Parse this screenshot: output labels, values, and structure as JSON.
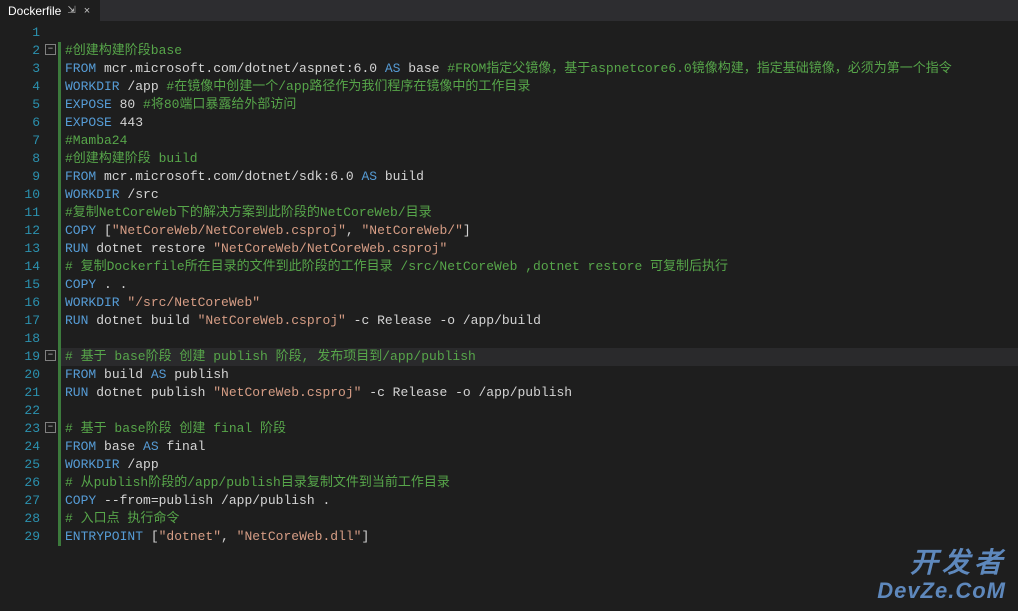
{
  "tab": {
    "title": "Dockerfile",
    "pin_glyph": "⇲",
    "close_glyph": "×"
  },
  "fold": {
    "glyph": "−"
  },
  "highlighted_line": 19,
  "watermark": {
    "line1": "开发者",
    "line2": "DevZe.CoM"
  },
  "lines": [
    {
      "n": 1,
      "fold": false,
      "indent": false,
      "tokens": []
    },
    {
      "n": 2,
      "fold": true,
      "indent": true,
      "tokens": [
        {
          "cls": "c-comment",
          "t": "#创建构建阶段base"
        }
      ]
    },
    {
      "n": 3,
      "fold": false,
      "indent": true,
      "tokens": [
        {
          "cls": "c-keyword",
          "t": "FROM"
        },
        {
          "cls": "c-text",
          "t": " mcr.microsoft.com/dotnet/aspnet:6.0 "
        },
        {
          "cls": "c-keyword",
          "t": "AS"
        },
        {
          "cls": "c-text",
          "t": " base "
        },
        {
          "cls": "c-comment",
          "t": "#FROM指定父镜像，基于aspnetcore6.0镜像构建，指定基础镜像，必须为第一个指令"
        }
      ]
    },
    {
      "n": 4,
      "fold": false,
      "indent": true,
      "tokens": [
        {
          "cls": "c-keyword",
          "t": "WORKDIR"
        },
        {
          "cls": "c-text",
          "t": " /app "
        },
        {
          "cls": "c-comment",
          "t": "#在镜像中创建一个/app路径作为我们程序在镜像中的工作目录"
        }
      ]
    },
    {
      "n": 5,
      "fold": false,
      "indent": true,
      "tokens": [
        {
          "cls": "c-keyword",
          "t": "EXPOSE"
        },
        {
          "cls": "c-text",
          "t": " 80 "
        },
        {
          "cls": "c-comment",
          "t": "#将80端口暴露给外部访问"
        }
      ]
    },
    {
      "n": 6,
      "fold": false,
      "indent": true,
      "tokens": [
        {
          "cls": "c-keyword",
          "t": "EXPOSE"
        },
        {
          "cls": "c-text",
          "t": " 443"
        }
      ]
    },
    {
      "n": 7,
      "fold": false,
      "indent": true,
      "tokens": [
        {
          "cls": "c-comment",
          "t": "#Mamba24"
        }
      ]
    },
    {
      "n": 8,
      "fold": false,
      "indent": true,
      "tokens": [
        {
          "cls": "c-comment",
          "t": "#创建构建阶段 build"
        }
      ]
    },
    {
      "n": 9,
      "fold": false,
      "indent": true,
      "tokens": [
        {
          "cls": "c-keyword",
          "t": "FROM"
        },
        {
          "cls": "c-text",
          "t": " mcr.microsoft.com/dotnet/sdk:6.0 "
        },
        {
          "cls": "c-keyword",
          "t": "AS"
        },
        {
          "cls": "c-text",
          "t": " build"
        }
      ]
    },
    {
      "n": 10,
      "fold": false,
      "indent": true,
      "tokens": [
        {
          "cls": "c-keyword",
          "t": "WORKDIR"
        },
        {
          "cls": "c-text",
          "t": " /src"
        }
      ]
    },
    {
      "n": 11,
      "fold": false,
      "indent": true,
      "tokens": [
        {
          "cls": "c-comment",
          "t": "#复制NetCoreWeb下的解决方案到此阶段的NetCoreWeb/目录"
        }
      ]
    },
    {
      "n": 12,
      "fold": false,
      "indent": true,
      "tokens": [
        {
          "cls": "c-keyword",
          "t": "COPY"
        },
        {
          "cls": "c-text",
          "t": " ["
        },
        {
          "cls": "c-string",
          "t": "\"NetCoreWeb/NetCoreWeb.csproj\""
        },
        {
          "cls": "c-text",
          "t": ", "
        },
        {
          "cls": "c-string",
          "t": "\"NetCoreWeb/\""
        },
        {
          "cls": "c-text",
          "t": "]"
        }
      ]
    },
    {
      "n": 13,
      "fold": false,
      "indent": true,
      "tokens": [
        {
          "cls": "c-keyword",
          "t": "RUN"
        },
        {
          "cls": "c-text",
          "t": " dotnet restore "
        },
        {
          "cls": "c-string",
          "t": "\"NetCoreWeb/NetCoreWeb.csproj\""
        }
      ]
    },
    {
      "n": 14,
      "fold": false,
      "indent": true,
      "tokens": [
        {
          "cls": "c-comment",
          "t": "# 复制Dockerfile所在目录的文件到此阶段的工作目录 /src/NetCoreWeb ,dotnet restore 可复制后执行"
        }
      ]
    },
    {
      "n": 15,
      "fold": false,
      "indent": true,
      "tokens": [
        {
          "cls": "c-keyword",
          "t": "COPY"
        },
        {
          "cls": "c-text",
          "t": " . ."
        }
      ]
    },
    {
      "n": 16,
      "fold": false,
      "indent": true,
      "tokens": [
        {
          "cls": "c-keyword",
          "t": "WORKDIR"
        },
        {
          "cls": "c-text",
          "t": " "
        },
        {
          "cls": "c-string",
          "t": "\"/src/NetCoreWeb\""
        }
      ]
    },
    {
      "n": 17,
      "fold": false,
      "indent": true,
      "tokens": [
        {
          "cls": "c-keyword",
          "t": "RUN"
        },
        {
          "cls": "c-text",
          "t": " dotnet build "
        },
        {
          "cls": "c-string",
          "t": "\"NetCoreWeb.csproj\""
        },
        {
          "cls": "c-text",
          "t": " -c Release -o /app/build"
        }
      ]
    },
    {
      "n": 18,
      "fold": false,
      "indent": true,
      "tokens": []
    },
    {
      "n": 19,
      "fold": true,
      "indent": true,
      "tokens": [
        {
          "cls": "c-comment",
          "t": "# 基于 base阶段 创建 publish 阶段, 发布项目到/app/publish"
        }
      ]
    },
    {
      "n": 20,
      "fold": false,
      "indent": true,
      "tokens": [
        {
          "cls": "c-keyword",
          "t": "FROM"
        },
        {
          "cls": "c-text",
          "t": " build "
        },
        {
          "cls": "c-keyword",
          "t": "AS"
        },
        {
          "cls": "c-text",
          "t": " publish"
        }
      ]
    },
    {
      "n": 21,
      "fold": false,
      "indent": true,
      "tokens": [
        {
          "cls": "c-keyword",
          "t": "RUN"
        },
        {
          "cls": "c-text",
          "t": " dotnet publish "
        },
        {
          "cls": "c-string",
          "t": "\"NetCoreWeb.csproj\""
        },
        {
          "cls": "c-text",
          "t": " -c Release -o /app/publish"
        }
      ]
    },
    {
      "n": 22,
      "fold": false,
      "indent": true,
      "tokens": []
    },
    {
      "n": 23,
      "fold": true,
      "indent": true,
      "tokens": [
        {
          "cls": "c-comment",
          "t": "# 基于 base阶段 创建 final 阶段"
        }
      ]
    },
    {
      "n": 24,
      "fold": false,
      "indent": true,
      "tokens": [
        {
          "cls": "c-keyword",
          "t": "FROM"
        },
        {
          "cls": "c-text",
          "t": " base "
        },
        {
          "cls": "c-keyword",
          "t": "AS"
        },
        {
          "cls": "c-text",
          "t": " final"
        }
      ]
    },
    {
      "n": 25,
      "fold": false,
      "indent": true,
      "tokens": [
        {
          "cls": "c-keyword",
          "t": "WORKDIR"
        },
        {
          "cls": "c-text",
          "t": " /app"
        }
      ]
    },
    {
      "n": 26,
      "fold": false,
      "indent": true,
      "tokens": [
        {
          "cls": "c-comment",
          "t": "# 从publish阶段的/app/publish目录复制文件到当前工作目录"
        }
      ]
    },
    {
      "n": 27,
      "fold": false,
      "indent": true,
      "tokens": [
        {
          "cls": "c-keyword",
          "t": "COPY"
        },
        {
          "cls": "c-text",
          "t": " --from=publish /app/publish ."
        }
      ]
    },
    {
      "n": 28,
      "fold": false,
      "indent": true,
      "tokens": [
        {
          "cls": "c-comment",
          "t": "# 入口点 执行命令"
        }
      ]
    },
    {
      "n": 29,
      "fold": false,
      "indent": true,
      "tokens": [
        {
          "cls": "c-keyword",
          "t": "ENTRYPOINT"
        },
        {
          "cls": "c-text",
          "t": " ["
        },
        {
          "cls": "c-string",
          "t": "\"dotnet\""
        },
        {
          "cls": "c-text",
          "t": ", "
        },
        {
          "cls": "c-string",
          "t": "\"NetCoreWeb.dll\""
        },
        {
          "cls": "c-text",
          "t": "]"
        }
      ]
    }
  ]
}
